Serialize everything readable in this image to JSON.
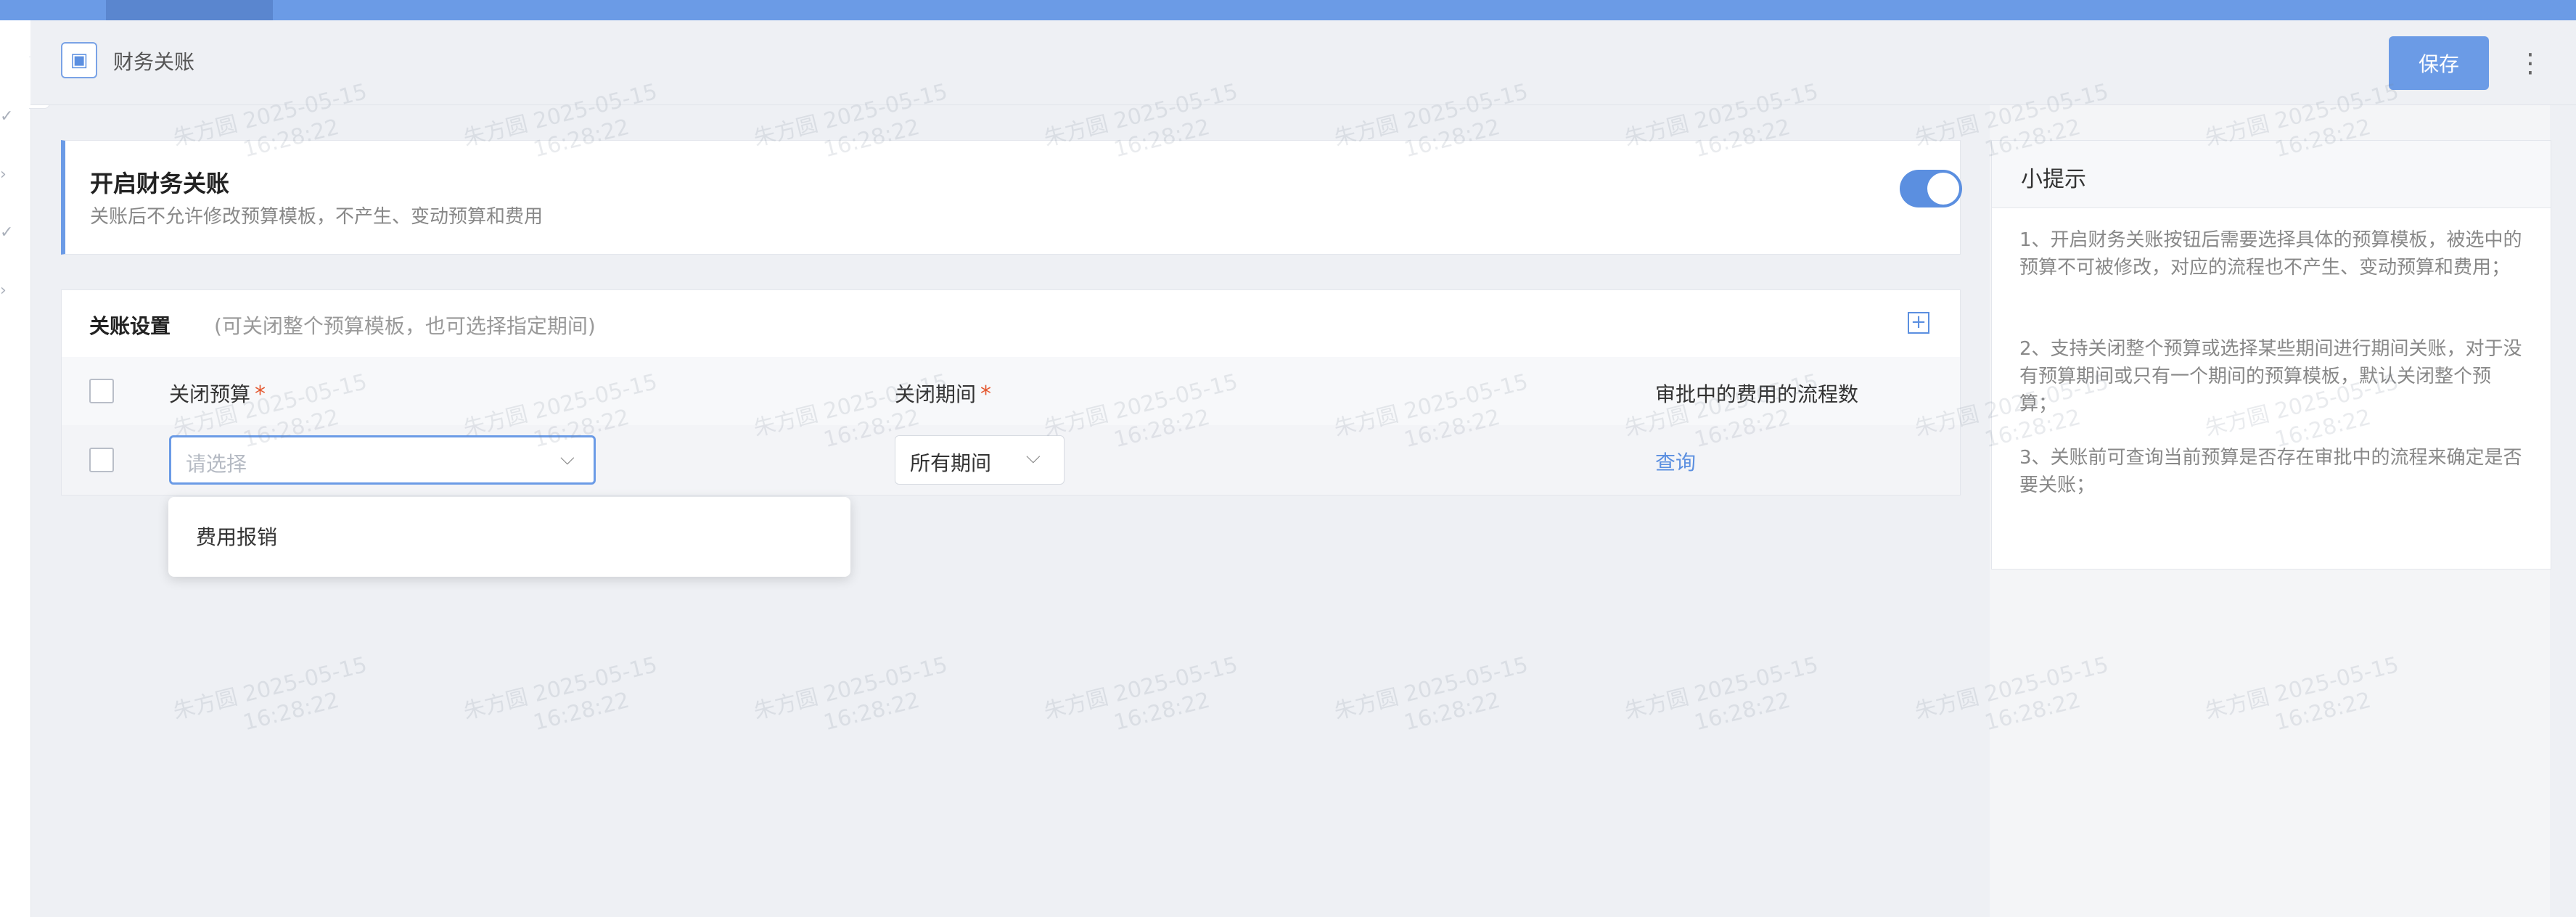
{
  "header": {
    "title": "财务关账",
    "save_label": "保存",
    "more_label": "⋮"
  },
  "close_card": {
    "title": "开启财务关账",
    "subtitle": "关账后不允许修改预算模板，不产生、变动预算和费用",
    "toggle_on": true
  },
  "settings": {
    "title": "关账设置",
    "note": "(可关闭整个预算模板，也可选择指定期间)",
    "columns": [
      "关闭预算",
      "关闭期间",
      "审批中的费用的流程数"
    ],
    "required_mark": "*",
    "row": {
      "budget_placeholder": "请选择",
      "period_value": "所有期间",
      "query_label": "查询"
    },
    "dropdown_options": [
      "费用报销"
    ]
  },
  "tips": {
    "title": "小提示",
    "items": [
      "1、开启财务关账按钮后需要选择具体的预算模板，被选中的预算不可被修改，对应的流程也不产生、变动预算和费用；",
      "2、支持关闭整个预算或选择某些期间进行期间关账，对于没有预算期间或只有一个期间的预算模板，默认关闭整个预算；",
      "3、关账前可查询当前预算是否存在审批中的流程来确定是否要关账；"
    ]
  },
  "watermark": {
    "name": "朱方圆",
    "date": "2025-05-15",
    "time": "16:28:22"
  },
  "colors": {
    "accent": "#6b9be6",
    "required": "#e4572e",
    "link": "#5b8fe0"
  }
}
